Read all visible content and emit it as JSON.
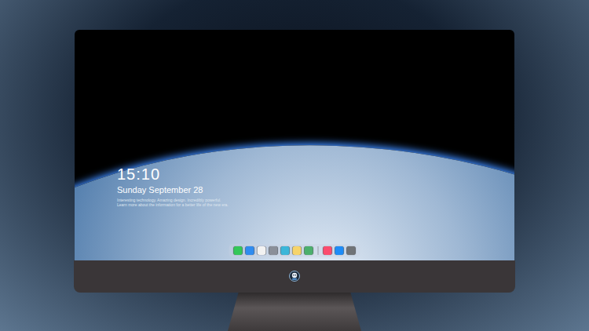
{
  "screen": {
    "time": "15:10",
    "date": "Sunday September 28",
    "caption": [
      "Interesting technology. Amazing design. Incredibly powerful.",
      "Learn more about the information for a better life of the new era."
    ]
  },
  "dock": [
    {
      "kind": "app",
      "color": "#34c759"
    },
    {
      "kind": "app",
      "color": "#2f8cf0"
    },
    {
      "kind": "app",
      "color": "#f2f2f2"
    },
    {
      "kind": "app",
      "color": "#8a8f99"
    },
    {
      "kind": "app",
      "color": "#3bb6d9"
    },
    {
      "kind": "app",
      "color": "#f6d46b"
    },
    {
      "kind": "app",
      "color": "#4caf6d"
    },
    {
      "kind": "separator",
      "color": "#9aa0a8"
    },
    {
      "kind": "app",
      "color": "#fb4c6e"
    },
    {
      "kind": "app",
      "color": "#1d8cf8"
    },
    {
      "kind": "app",
      "color": "#707377"
    }
  ]
}
